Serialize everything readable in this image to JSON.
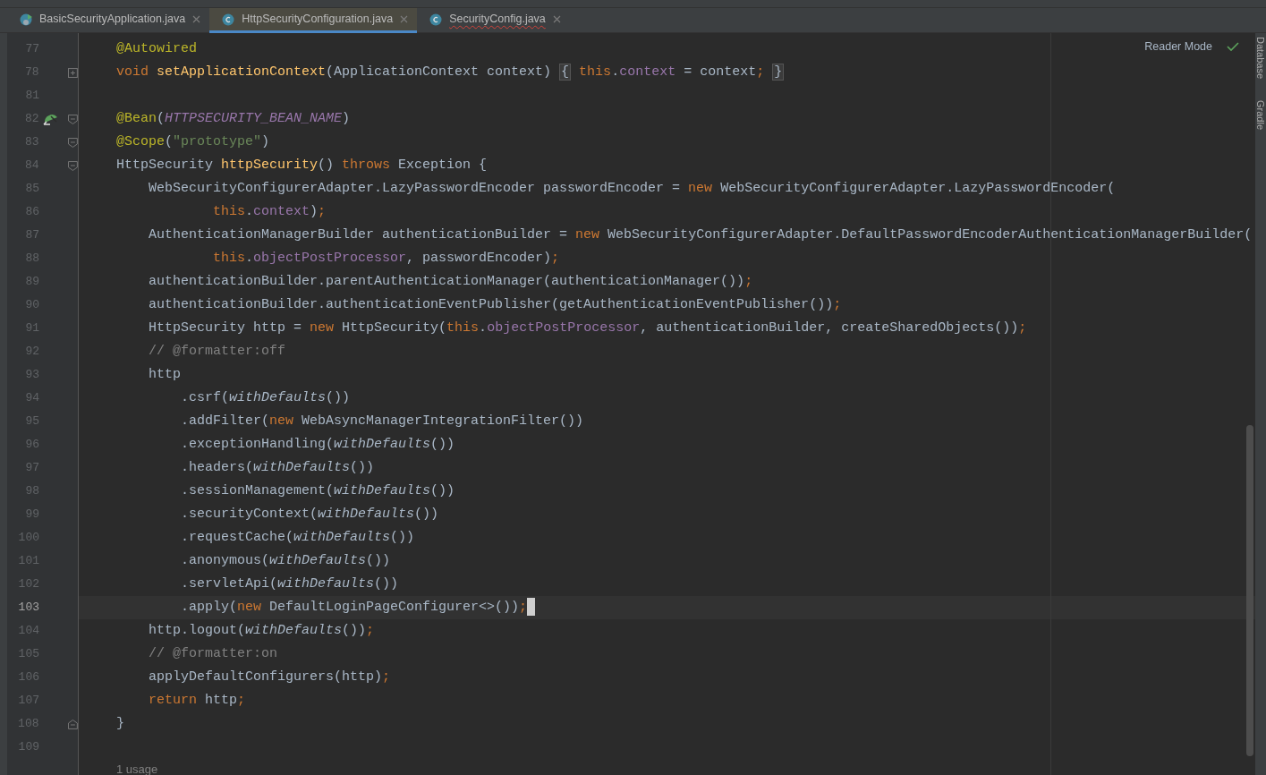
{
  "tabs": [
    {
      "label": "BasicSecurityApplication.java",
      "kind": "app",
      "selected": false,
      "error": false
    },
    {
      "label": "HttpSecurityConfiguration.java",
      "kind": "class",
      "selected": true,
      "error": false
    },
    {
      "label": "SecurityConfig.java",
      "kind": "class",
      "selected": false,
      "error": true
    }
  ],
  "reader_mode": "Reader Mode",
  "side_tools": [
    "Database",
    "Gradle"
  ],
  "lines": [
    {
      "number": "77",
      "tokens": [
        {
          "text": "@Autowired",
          "kind": "ann"
        }
      ]
    },
    {
      "number": "78",
      "marker": {
        "kind": "expand"
      },
      "tokens": [
        {
          "text": "void ",
          "kind": "kw"
        },
        {
          "text": "setApplicationContext",
          "kind": "fn"
        },
        {
          "text": "(ApplicationContext context) ",
          "kind": "plain"
        },
        {
          "text": "{",
          "kind": "fold"
        },
        {
          "text": " this",
          "kind": "kw"
        },
        {
          "text": ".",
          "kind": "plain"
        },
        {
          "text": "context",
          "kind": "field"
        },
        {
          "text": " = context",
          "kind": "plain"
        },
        {
          "text": ";",
          "kind": "kw"
        },
        {
          "text": "}",
          "kind": "fold"
        }
      ]
    },
    {
      "number": "81"
    },
    {
      "number": "82",
      "gutter": {
        "kind": "bean"
      },
      "marker": {
        "kind": "start"
      },
      "tokens": [
        {
          "text": "@Bean",
          "kind": "ann"
        },
        {
          "text": "(",
          "kind": "plain"
        },
        {
          "text": "HTTPSECURITY_BEAN_NAME",
          "kind": "const"
        },
        {
          "text": ")",
          "kind": "plain"
        }
      ]
    },
    {
      "number": "83",
      "marker": {
        "kind": "start"
      },
      "tokens": [
        {
          "text": "@Scope",
          "kind": "ann"
        },
        {
          "text": "(",
          "kind": "plain"
        },
        {
          "text": "\"prototype\"",
          "kind": "str"
        },
        {
          "text": ")",
          "kind": "plain"
        }
      ]
    },
    {
      "number": "84",
      "marker": {
        "kind": "start"
      },
      "tokens": [
        {
          "text": "HttpSecurity ",
          "kind": "plain"
        },
        {
          "text": "httpSecurity",
          "kind": "fn"
        },
        {
          "text": "() ",
          "kind": "plain"
        },
        {
          "text": "throws",
          "kind": "kw"
        },
        {
          "text": " Exception {",
          "kind": "plain"
        }
      ]
    },
    {
      "number": "85",
      "tokens": [
        {
          "text": "    WebSecurityConfigurerAdapter.LazyPasswordEncoder passwordEncoder = ",
          "kind": "plain"
        },
        {
          "text": "new",
          "kind": "kw"
        },
        {
          "text": " WebSecurityConfigurerAdapter.LazyPasswordEncoder(",
          "kind": "plain"
        }
      ]
    },
    {
      "number": "86",
      "tokens": [
        {
          "text": "            this",
          "kind": "kw"
        },
        {
          "text": ".",
          "kind": "plain"
        },
        {
          "text": "context",
          "kind": "field"
        },
        {
          "text": ")",
          "kind": "plain"
        },
        {
          "text": ";",
          "kind": "kw"
        }
      ]
    },
    {
      "number": "87",
      "tokens": [
        {
          "text": "    AuthenticationManagerBuilder authenticationBuilder = ",
          "kind": "plain"
        },
        {
          "text": "new",
          "kind": "kw"
        },
        {
          "text": " WebSecurityConfigurerAdapter.DefaultPasswordEncoderAuthenticationManagerBuilder(",
          "kind": "plain"
        }
      ]
    },
    {
      "number": "88",
      "tokens": [
        {
          "text": "            this",
          "kind": "kw"
        },
        {
          "text": ".",
          "kind": "plain"
        },
        {
          "text": "objectPostProcessor",
          "kind": "field"
        },
        {
          "text": ", passwordEncoder)",
          "kind": "plain"
        },
        {
          "text": ";",
          "kind": "kw"
        }
      ]
    },
    {
      "number": "89",
      "tokens": [
        {
          "text": "    authenticationBuilder.parentAuthenticationManager(authenticationManager())",
          "kind": "plain"
        },
        {
          "text": ";",
          "kind": "kw"
        }
      ]
    },
    {
      "number": "90",
      "tokens": [
        {
          "text": "    authenticationBuilder.authenticationEventPublisher(getAuthenticationEventPublisher())",
          "kind": "plain"
        },
        {
          "text": ";",
          "kind": "kw"
        }
      ]
    },
    {
      "number": "91",
      "tokens": [
        {
          "text": "    HttpSecurity http = ",
          "kind": "plain"
        },
        {
          "text": "new",
          "kind": "kw"
        },
        {
          "text": " HttpSecurity(",
          "kind": "plain"
        },
        {
          "text": "this",
          "kind": "kw"
        },
        {
          "text": ".",
          "kind": "plain"
        },
        {
          "text": "objectPostProcessor",
          "kind": "field"
        },
        {
          "text": ", authenticationBuilder, createSharedObjects())",
          "kind": "plain"
        },
        {
          "text": ";",
          "kind": "kw"
        }
      ]
    },
    {
      "number": "92",
      "tokens": [
        {
          "text": "    // @formatter:off",
          "kind": "cmt"
        }
      ]
    },
    {
      "number": "93",
      "tokens": [
        {
          "text": "    http",
          "kind": "plain"
        }
      ]
    },
    {
      "number": "94",
      "tokens": [
        {
          "text": "        .csrf(",
          "kind": "plain"
        },
        {
          "text": "withDefaults",
          "kind": "it"
        },
        {
          "text": "())",
          "kind": "plain"
        }
      ]
    },
    {
      "number": "95",
      "tokens": [
        {
          "text": "        .addFilter(",
          "kind": "plain"
        },
        {
          "text": "new",
          "kind": "kw"
        },
        {
          "text": " WebAsyncManagerIntegrationFilter())",
          "kind": "plain"
        }
      ]
    },
    {
      "number": "96",
      "tokens": [
        {
          "text": "        .exceptionHandling(",
          "kind": "plain"
        },
        {
          "text": "withDefaults",
          "kind": "it"
        },
        {
          "text": "())",
          "kind": "plain"
        }
      ]
    },
    {
      "number": "97",
      "tokens": [
        {
          "text": "        .headers(",
          "kind": "plain"
        },
        {
          "text": "withDefaults",
          "kind": "it"
        },
        {
          "text": "())",
          "kind": "plain"
        }
      ]
    },
    {
      "number": "98",
      "tokens": [
        {
          "text": "        .sessionManagement(",
          "kind": "plain"
        },
        {
          "text": "withDefaults",
          "kind": "it"
        },
        {
          "text": "())",
          "kind": "plain"
        }
      ]
    },
    {
      "number": "99",
      "tokens": [
        {
          "text": "        .securityContext(",
          "kind": "plain"
        },
        {
          "text": "withDefaults",
          "kind": "it"
        },
        {
          "text": "())",
          "kind": "plain"
        }
      ]
    },
    {
      "number": "100",
      "tokens": [
        {
          "text": "        .requestCache(",
          "kind": "plain"
        },
        {
          "text": "withDefaults",
          "kind": "it"
        },
        {
          "text": "())",
          "kind": "plain"
        }
      ]
    },
    {
      "number": "101",
      "tokens": [
        {
          "text": "        .anonymous(",
          "kind": "plain"
        },
        {
          "text": "withDefaults",
          "kind": "it"
        },
        {
          "text": "())",
          "kind": "plain"
        }
      ]
    },
    {
      "number": "102",
      "tokens": [
        {
          "text": "        .servletApi(",
          "kind": "plain"
        },
        {
          "text": "withDefaults",
          "kind": "it"
        },
        {
          "text": "())",
          "kind": "plain"
        }
      ]
    },
    {
      "number": "103",
      "current": true,
      "tokens": [
        {
          "text": "        .apply(",
          "kind": "plain"
        },
        {
          "text": "new",
          "kind": "kw"
        },
        {
          "text": " DefaultLoginPageConfigurer<>())",
          "kind": "plain"
        },
        {
          "text": ";",
          "kind": "kw"
        }
      ]
    },
    {
      "number": "104",
      "tokens": [
        {
          "text": "    http.logout(",
          "kind": "plain"
        },
        {
          "text": "withDefaults",
          "kind": "it"
        },
        {
          "text": "())",
          "kind": "plain"
        },
        {
          "text": ";",
          "kind": "kw"
        }
      ]
    },
    {
      "number": "105",
      "tokens": [
        {
          "text": "    // @formatter:on",
          "kind": "cmt"
        }
      ]
    },
    {
      "number": "106",
      "tokens": [
        {
          "text": "    applyDefaultConfigurers(http)",
          "kind": "plain"
        },
        {
          "text": ";",
          "kind": "kw"
        }
      ]
    },
    {
      "number": "107",
      "tokens": [
        {
          "text": "    return",
          "kind": "kw"
        },
        {
          "text": " http",
          "kind": "plain"
        },
        {
          "text": ";",
          "kind": "kw"
        }
      ]
    },
    {
      "number": "108",
      "marker": {
        "kind": "end"
      },
      "tokens": [
        {
          "text": "}",
          "kind": "plain"
        }
      ]
    },
    {
      "number": "109"
    }
  ],
  "usages": "1 usage"
}
